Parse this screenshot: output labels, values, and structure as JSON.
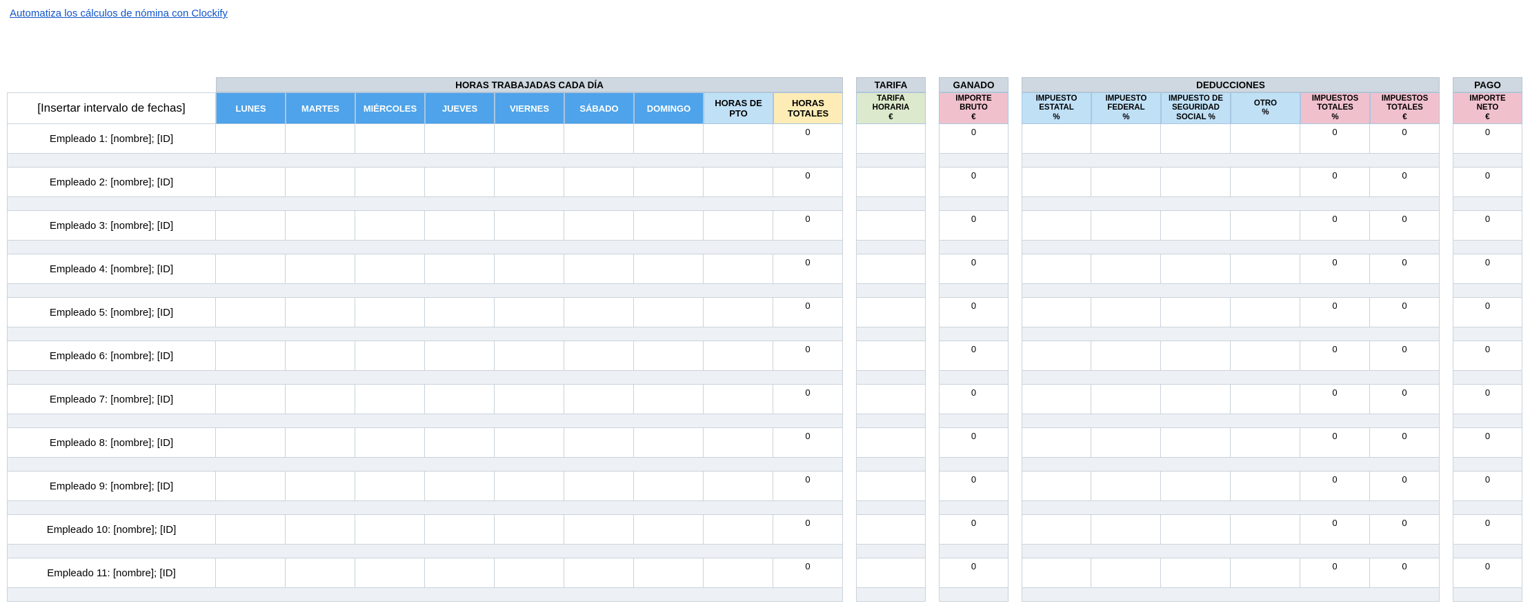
{
  "link": {
    "text": "Automatiza los cálculos de nómina con Clockify"
  },
  "date_range": "[Insertar intervalo de fechas]",
  "groups": [
    {
      "label": "HORAS TRABAJADAS CADA DÍA",
      "cols": [
        1,
        9
      ]
    },
    {
      "label": "TARIFA",
      "cols": [
        10,
        10
      ]
    },
    {
      "label": "GANADO",
      "cols": [
        11,
        11
      ]
    },
    {
      "label": "DEDUCCIONES",
      "cols": [
        12,
        17
      ]
    },
    {
      "label": "PAGO",
      "cols": [
        18,
        18
      ]
    }
  ],
  "columns": [
    {
      "label": "LUNES",
      "color": "blue-day"
    },
    {
      "label": "MARTES",
      "color": "blue-day"
    },
    {
      "label": "MIÉRCOLES",
      "color": "blue-day"
    },
    {
      "label": "JUEVES",
      "color": "blue-day"
    },
    {
      "label": "VIERNES",
      "color": "blue-day"
    },
    {
      "label": "SÁBADO",
      "color": "blue-day"
    },
    {
      "label": "DOMINGO",
      "color": "blue-day"
    },
    {
      "label": "HORAS DE\nPTO",
      "color": "lblue"
    },
    {
      "label": "HORAS\nTOTALES",
      "color": "yellow"
    },
    {
      "label": "TARIFA\nHORARIA\n€",
      "color": "green",
      "small": true
    },
    {
      "label": "IMPORTE\nBRUTO\n€",
      "color": "pink",
      "small": true
    },
    {
      "label": "IMPUESTO\nESTATAL\n%",
      "color": "lblue",
      "small": true
    },
    {
      "label": "IMPUESTO\nFEDERAL\n%",
      "color": "lblue",
      "small": true
    },
    {
      "label": "IMPUESTO DE\nSEGURIDAD\nSOCIAL %",
      "color": "lblue",
      "small": true
    },
    {
      "label": "OTRO\n%",
      "color": "lblue",
      "small": true
    },
    {
      "label": "IMPUESTOS\nTOTALES\n%",
      "color": "pink",
      "small": true
    },
    {
      "label": "IMPUESTOS\nTOTALES\n€",
      "color": "pink",
      "small": true
    },
    {
      "label": "IMPORTE\nNETO\n€",
      "color": "pink",
      "small": true
    }
  ],
  "computed_columns": [
    9,
    11,
    16,
    17,
    18
  ],
  "computed_value": "0",
  "employees": [
    "Empleado 1: [nombre]; [ID]",
    "Empleado 2: [nombre]; [ID]",
    "Empleado 3: [nombre]; [ID]",
    "Empleado 4: [nombre]; [ID]",
    "Empleado 5: [nombre]; [ID]",
    "Empleado 6: [nombre]; [ID]",
    "Empleado 7: [nombre]; [ID]",
    "Empleado 8: [nombre]; [ID]",
    "Empleado 9: [nombre]; [ID]",
    "Empleado 10: [nombre]; [ID]",
    "Empleado 11: [nombre]; [ID]"
  ]
}
